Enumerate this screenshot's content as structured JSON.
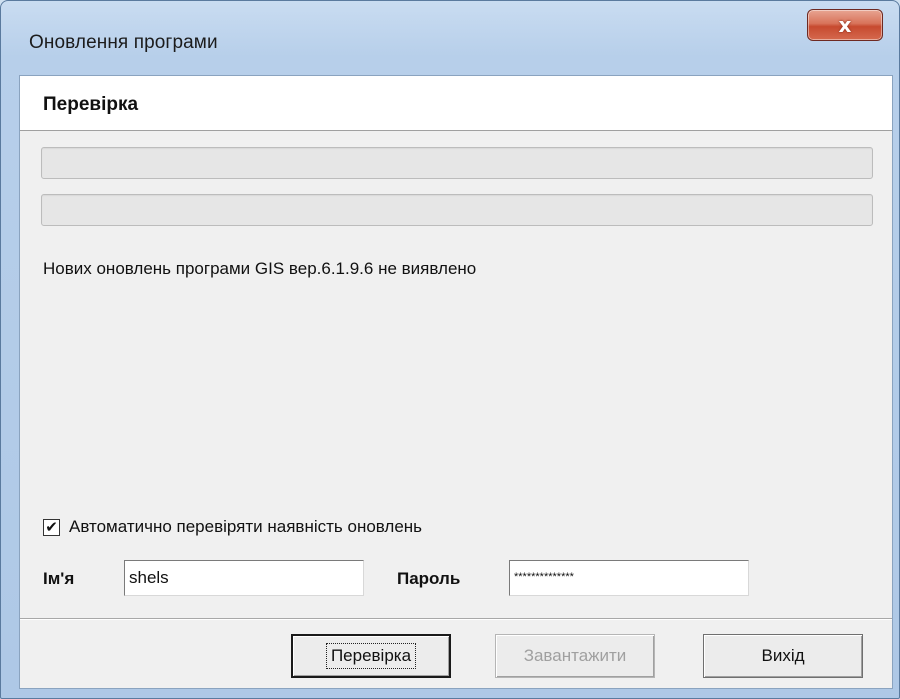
{
  "window": {
    "title": "Оновлення програми",
    "close_symbol": "x",
    "close_icon": "close-icon"
  },
  "header": {
    "title": "Перевірка"
  },
  "progress": {
    "bar1_fraction": 0,
    "bar2_fraction": 0
  },
  "status": {
    "message": "Нових оновлень програми GIS вер.6.1.9.6 не виявлено"
  },
  "auto_check": {
    "label": "Автоматично перевіряти наявність оновлень",
    "checked": true,
    "check_mark": "✔"
  },
  "credentials": {
    "name_label": "Ім'я",
    "name_value": "shels",
    "password_label": "Пароль",
    "password_value": "**************"
  },
  "buttons": {
    "check_label": "Перевірка",
    "download_label": "Завантажити",
    "exit_label": "Вихід"
  }
}
